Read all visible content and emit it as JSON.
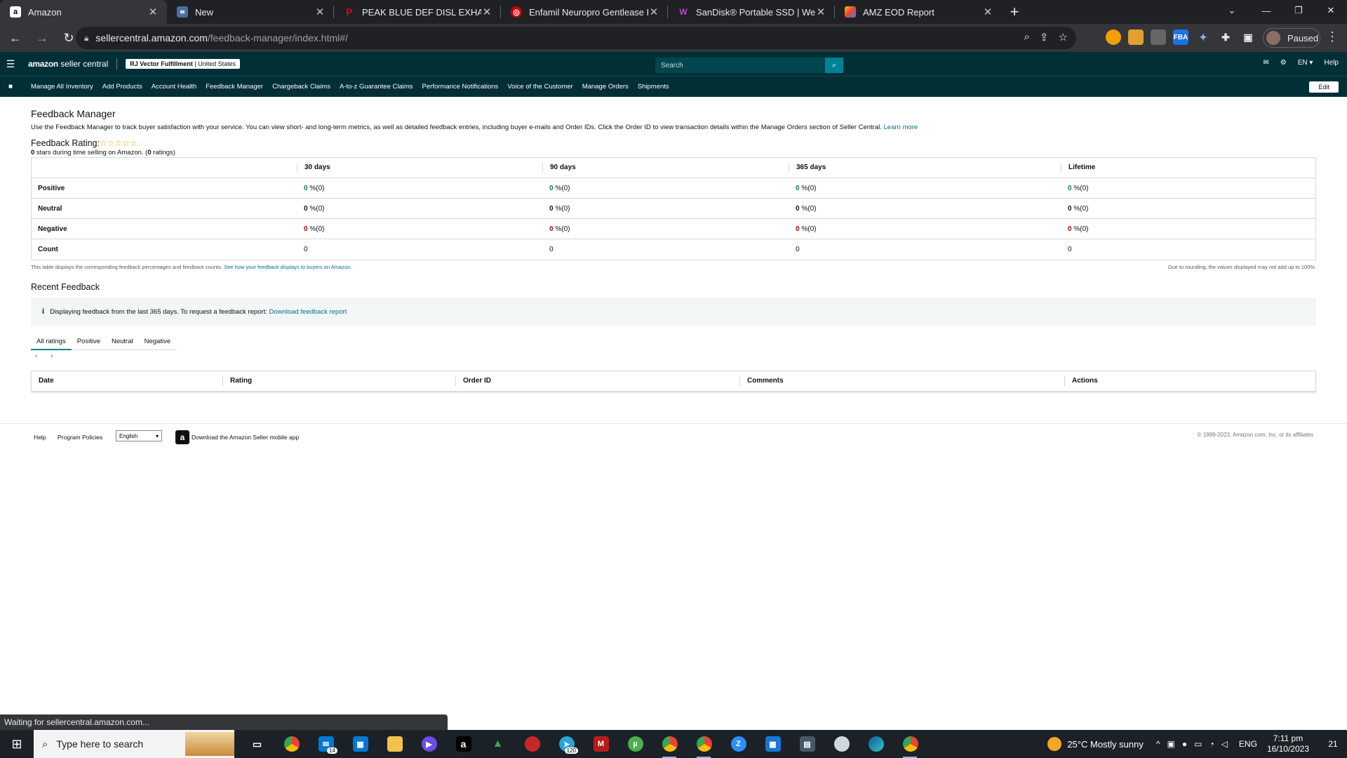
{
  "browser": {
    "tabs": [
      {
        "title": "Amazon",
        "favicon": "amazon-icon",
        "active": true
      },
      {
        "title": "New",
        "favicon": "mail-icon",
        "active": false
      },
      {
        "title": "PEAK BLUE DEF DISL EXHAUST F",
        "favicon": "pinterest-icon",
        "active": false
      },
      {
        "title": "Enfamil Neuropro Gentlease Pov",
        "favicon": "target-icon",
        "active": false
      },
      {
        "title": "SanDisk® Portable SSD | Wester",
        "favicon": "sandisk-icon",
        "active": false
      },
      {
        "title": "AMZ EOD Report",
        "favicon": "sheets-icon",
        "active": false
      }
    ],
    "url_host": "sellercentral.amazon.com",
    "url_path": "/feedback-manager/index.html#/",
    "profile_label": "Paused",
    "status_text": "Waiting for sellercentral.amazon.com..."
  },
  "header": {
    "logo_bold": "amazon",
    "logo_rest": " seller central",
    "store_name": "RJ Vector Fulfillment",
    "store_region": "United States",
    "search_placeholder": "Search",
    "lang": "EN ▾",
    "help": "Help"
  },
  "nav": {
    "links": [
      "Manage All Inventory",
      "Add Products",
      "Account Health",
      "Feedback Manager",
      "Chargeback Claims",
      "A-to-z Guarantee Claims",
      "Performance Notifications",
      "Voice of the Customer",
      "Manage Orders",
      "Shipments"
    ],
    "edit": "Edit"
  },
  "page": {
    "title": "Feedback Manager",
    "description": "Use the Feedback Manager to track buyer satisfaction with your service. You can view short- and long-term metrics, as well as detailed feedback entries, including buyer e-mails and Order IDs. Click the Order ID to view transaction details within the Manage Orders section of Seller Central.",
    "learn_more": "Learn more",
    "rating_label": "Feedback Rating:",
    "rating_stars": "☆☆☆☆☆",
    "rating_stars_value": "0",
    "rating_sub_prefix": " stars during time selling on Amazon. (",
    "rating_count": "0",
    "rating_sub_suffix": " ratings)"
  },
  "metrics": {
    "columns": [
      "",
      "30 days",
      "90 days",
      "365 days",
      "Lifetime"
    ],
    "rows": [
      {
        "label": "Positive",
        "values": [
          "0",
          "0",
          "0",
          "0"
        ],
        "suffix": " %(0)"
      },
      {
        "label": "Neutral",
        "values": [
          "0",
          "0",
          "0",
          "0"
        ],
        "suffix": " %(0)"
      },
      {
        "label": "Negative",
        "values": [
          "0",
          "0",
          "0",
          "0"
        ],
        "suffix": " %(0)"
      },
      {
        "label": "Count",
        "values": [
          "0",
          "0",
          "0",
          "0"
        ],
        "suffix": ""
      }
    ],
    "note": "This table displays the corresponding feedback percentages and feedback counts.",
    "note_link": "See how your feedback displays to buyers on Amazon.",
    "rounding_note": "Due to rounding, the values displayed may not add up to 100%."
  },
  "recent": {
    "title": "Recent Feedback",
    "info_text": "Displaying feedback from the last 365 days. To request a feedback report:",
    "info_link": "Download feedback report",
    "tabs": [
      "All ratings",
      "Positive",
      "Neutral",
      "Negative"
    ],
    "pager": "‹ ›",
    "columns": [
      "Date",
      "Rating",
      "Order ID",
      "Comments",
      "Actions"
    ]
  },
  "footer": {
    "help": "Help",
    "policies": "Program Policies",
    "language": "English",
    "app_text": "Download the Amazon Seller mobile app",
    "copyright": "© 1999-2023, Amazon.com, Inc. or its affiliates"
  },
  "taskbar": {
    "search_placeholder": "Type here to search",
    "weather": "25°C  Mostly sunny",
    "lang": "ENG",
    "time": "7:11 pm",
    "date": "16/10/2023",
    "notif_count": "21",
    "mail_badge": "14",
    "telegram_badge": "120"
  },
  "colors": {
    "header_bg": "#002f36",
    "positive": "#067d62",
    "negative": "#c40000",
    "link": "#007185"
  }
}
